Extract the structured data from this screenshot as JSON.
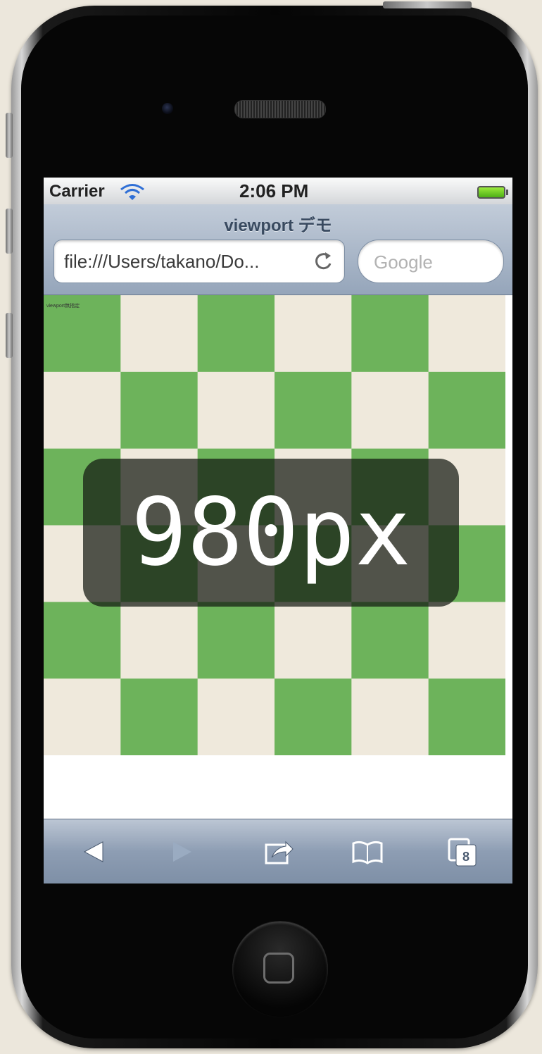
{
  "status_bar": {
    "carrier": "Carrier",
    "time": "2:06 PM",
    "wifi_icon": "wifi-icon",
    "battery_icon": "battery-full-icon"
  },
  "browser": {
    "page_title": "viewport デモ",
    "url": "file:///Users/takano/Do...",
    "search_placeholder": "Google",
    "reload_icon": "reload-icon"
  },
  "content": {
    "tiny_label": "viewport無指定",
    "overlay_text": "980px",
    "checker_colors": {
      "green": "#6db35b",
      "cream": "#efe9dc"
    }
  },
  "toolbar": {
    "icons": [
      "back-arrow-icon",
      "forward-arrow-icon",
      "share-icon",
      "bookmarks-icon",
      "tabs-icon"
    ],
    "tabs_count": "8"
  },
  "colors": {
    "background": "#ece7dc",
    "toolbar_blue": "#8d9db3"
  }
}
